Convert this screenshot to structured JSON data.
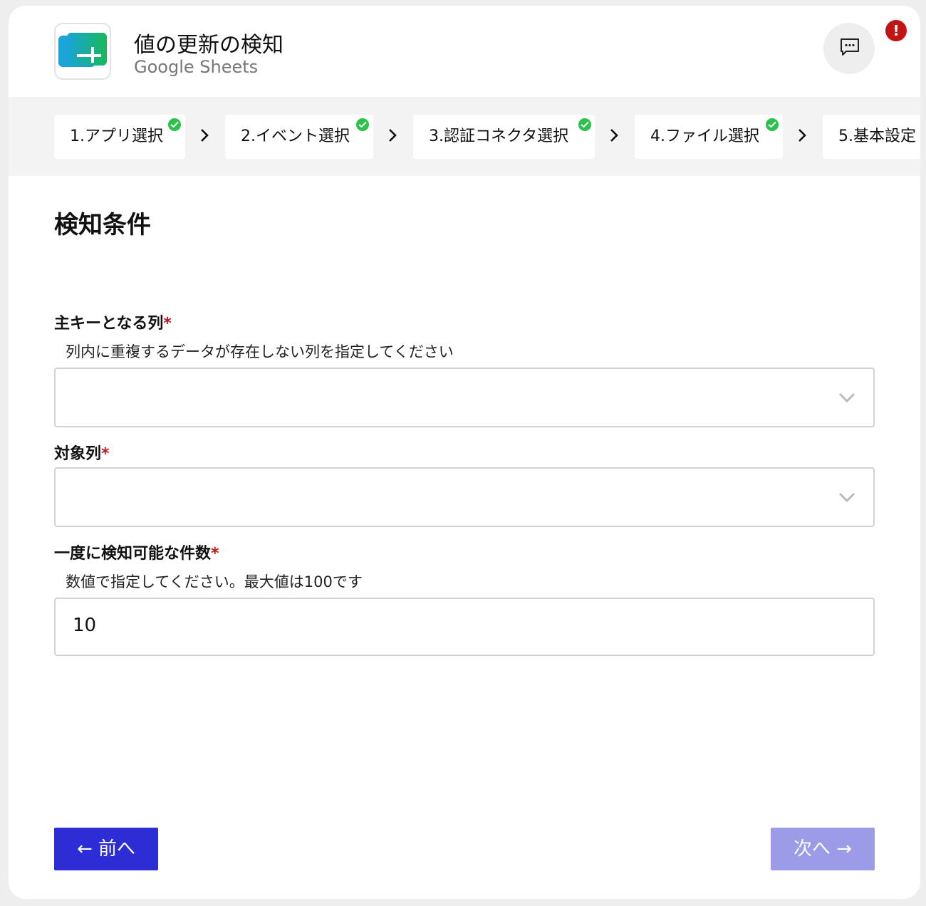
{
  "header": {
    "title": "値の更新の検知",
    "subtitle": "Google Sheets",
    "app_icon": "google-sheets-icon",
    "chat_icon": "chat-bubble-icon",
    "alert_badge": "!"
  },
  "stepper": {
    "steps": [
      {
        "label": "1.アプリ選択",
        "completed": true
      },
      {
        "label": "2.イベント選択",
        "completed": true
      },
      {
        "label": "3.認証コネクタ選択",
        "completed": true
      },
      {
        "label": "4.ファイル選択",
        "completed": true
      },
      {
        "label": "5.基本設定",
        "completed": false
      }
    ]
  },
  "form": {
    "section_title": "検知条件",
    "primary_key": {
      "label": "主キーとなる列",
      "required_mark": "*",
      "hint": "列内に重複するデータが存在しない列を指定してください",
      "value": ""
    },
    "target_column": {
      "label": "対象列",
      "required_mark": "*",
      "value": ""
    },
    "batch_count": {
      "label": "一度に検知可能な件数",
      "required_mark": "*",
      "hint": "数値で指定してください。最大値は100です",
      "value": "10"
    }
  },
  "footer": {
    "prev_label": "← 前へ",
    "next_label": "次へ →"
  },
  "colors": {
    "accent": "#2d2dd6",
    "accent_disabled": "#9b9be8",
    "required": "#c21414",
    "check": "#2bc24b"
  }
}
